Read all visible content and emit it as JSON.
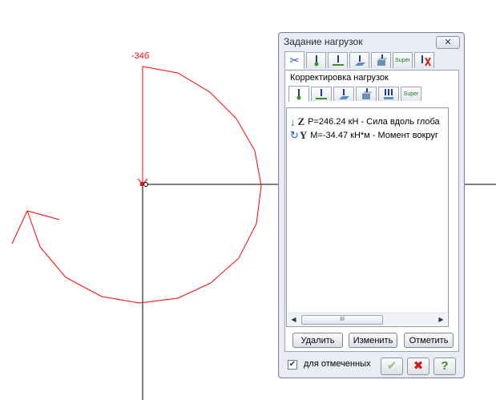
{
  "canvas": {
    "node_label": "-34б",
    "curve_color": "#ff0000",
    "axis_color": "#000000"
  },
  "dialog": {
    "title": "Задание нагрузок",
    "close_icon": "close-icon",
    "top_tabs": [
      {
        "icon": "scissors-icon",
        "label": ""
      },
      {
        "icon": "node-load-icon",
        "label": ""
      },
      {
        "icon": "bar-load-icon",
        "label": ""
      },
      {
        "icon": "plate-load-icon",
        "label": ""
      },
      {
        "icon": "solid-load-icon",
        "label": ""
      },
      {
        "icon": "super-icon",
        "label": "Super"
      },
      {
        "icon": "correct-icon",
        "label": ""
      }
    ],
    "group_title": "Корректировка нагрузок",
    "sub_tabs": [
      {
        "icon": "node-load-icon",
        "label": ""
      },
      {
        "icon": "bar-load-icon",
        "label": ""
      },
      {
        "icon": "plate-load-icon",
        "label": ""
      },
      {
        "icon": "solid-load-icon",
        "label": ""
      },
      {
        "icon": "multi-load-icon",
        "label": ""
      },
      {
        "icon": "super-icon",
        "label": "Super"
      }
    ],
    "loads": [
      {
        "icon": "force-arrow-icon",
        "axis": "Z",
        "text": "P=246.24 кН - Сила вдоль глоба"
      },
      {
        "icon": "moment-icon",
        "axis": "Y",
        "text": "M=-34.47 кН*м - Момент вокруг"
      }
    ],
    "scroll_thumb": "III",
    "buttons": {
      "delete": "Удалить",
      "edit": "Изменить",
      "mark": "Отметить"
    },
    "checkbox": {
      "label": "для отмеченных",
      "checked": true
    },
    "footer_icons": [
      "apply-check-icon",
      "cancel-x-icon",
      "help-icon"
    ]
  }
}
